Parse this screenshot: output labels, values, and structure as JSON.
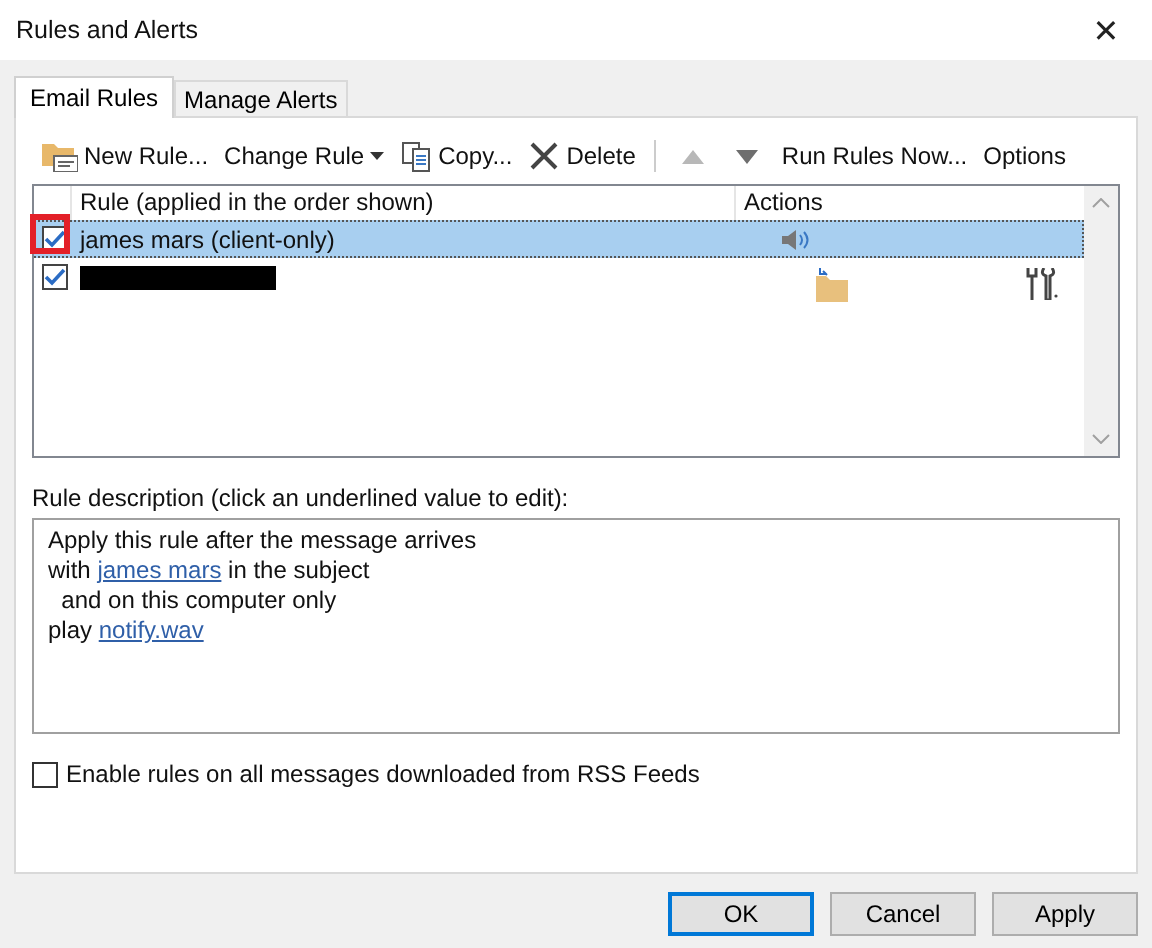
{
  "window": {
    "title": "Rules and Alerts",
    "close": "✕"
  },
  "tabs": [
    {
      "label": "Email Rules",
      "selected": true
    },
    {
      "label": "Manage Alerts",
      "selected": false
    }
  ],
  "toolbar": [
    {
      "kind": "new",
      "label": "New Rule...",
      "disabled": false
    },
    {
      "kind": "change",
      "label": "Change Rule",
      "disabled": false
    },
    {
      "kind": "copy",
      "label": "Copy...",
      "disabled": false
    },
    {
      "kind": "delete",
      "label": "Delete",
      "disabled": false
    },
    {
      "kind": "separator"
    },
    {
      "kind": "up",
      "disabled": true
    },
    {
      "kind": "down",
      "disabled": false
    },
    {
      "kind": "run",
      "label": "Run Rules Now...",
      "disabled": false
    },
    {
      "kind": "options",
      "label": "Options",
      "disabled": false
    }
  ],
  "table": {
    "columns": [
      "Rule (applied in the order shown)",
      "Actions"
    ],
    "rows": [
      {
        "name": "james mars  (client-only)",
        "redacted": false,
        "checked": true,
        "selected": true,
        "highlighted": true,
        "actions": [
          {
            "kind": "sound"
          }
        ]
      },
      {
        "name": "",
        "redacted": true,
        "checked": true,
        "selected": false,
        "highlighted": false,
        "actions": [
          {
            "kind": "move"
          },
          {
            "kind": "tools"
          }
        ]
      }
    ]
  },
  "description": {
    "label": "Rule description (click an underlined value to edit):",
    "lines": [
      [
        {
          "text": "Apply this rule after the message arrives"
        }
      ],
      [
        {
          "text": "with "
        },
        {
          "link": "james mars"
        },
        {
          "text": " in the subject"
        }
      ],
      [
        {
          "text": "  and on this computer only"
        }
      ],
      [
        {
          "text": "play "
        },
        {
          "link": "notify.wav"
        }
      ]
    ]
  },
  "rss": {
    "label": "Enable rules on all messages downloaded from RSS Feeds",
    "checked": false
  },
  "buttons": [
    {
      "label": "OK",
      "default": true
    },
    {
      "label": "Cancel",
      "default": false
    },
    {
      "label": "Apply",
      "default": false
    }
  ]
}
